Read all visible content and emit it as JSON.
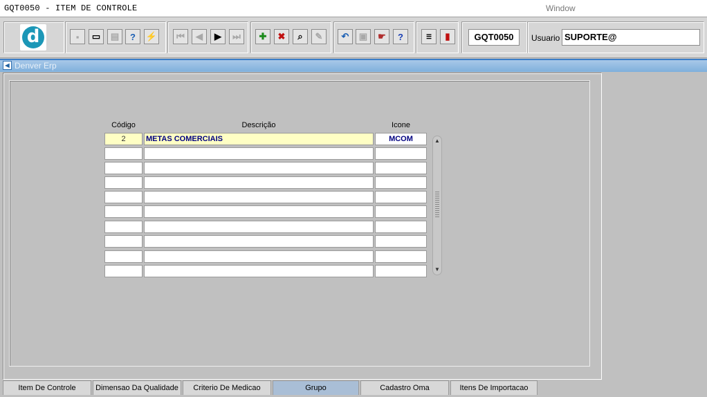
{
  "menubar": {
    "title": "GQT0050 - ITEM DE CONTROLE",
    "window_menu": "Window"
  },
  "toolbar": {
    "logo": "d",
    "module_code": "GQT0050",
    "user_label": "Usuario",
    "user_value": "SUPORTE@"
  },
  "window": {
    "title": "Denver Erp"
  },
  "table": {
    "headers": {
      "codigo": "Código",
      "descricao": "Descrição",
      "icone": "Icone"
    },
    "rows": [
      {
        "codigo": "2",
        "descricao": "METAS COMERCIAIS",
        "icone": "MCOM"
      },
      {
        "codigo": "",
        "descricao": "",
        "icone": ""
      },
      {
        "codigo": "",
        "descricao": "",
        "icone": ""
      },
      {
        "codigo": "",
        "descricao": "",
        "icone": ""
      },
      {
        "codigo": "",
        "descricao": "",
        "icone": ""
      },
      {
        "codigo": "",
        "descricao": "",
        "icone": ""
      },
      {
        "codigo": "",
        "descricao": "",
        "icone": ""
      },
      {
        "codigo": "",
        "descricao": "",
        "icone": ""
      },
      {
        "codigo": "",
        "descricao": "",
        "icone": ""
      },
      {
        "codigo": "",
        "descricao": "",
        "icone": ""
      }
    ]
  },
  "tabs": [
    {
      "label": "Item De Controle"
    },
    {
      "label": "Dimensao Da Qualidade"
    },
    {
      "label": "Criterio De Medicao"
    },
    {
      "label": "Grupo",
      "active": true
    },
    {
      "label": "Cadastro Oma"
    },
    {
      "label": "Itens De Importacao"
    }
  ],
  "colors": {
    "accent": "#1c97b7",
    "selected_row": "#ffffc4",
    "active_tab": "#a9bed6",
    "text_value": "#000080"
  }
}
